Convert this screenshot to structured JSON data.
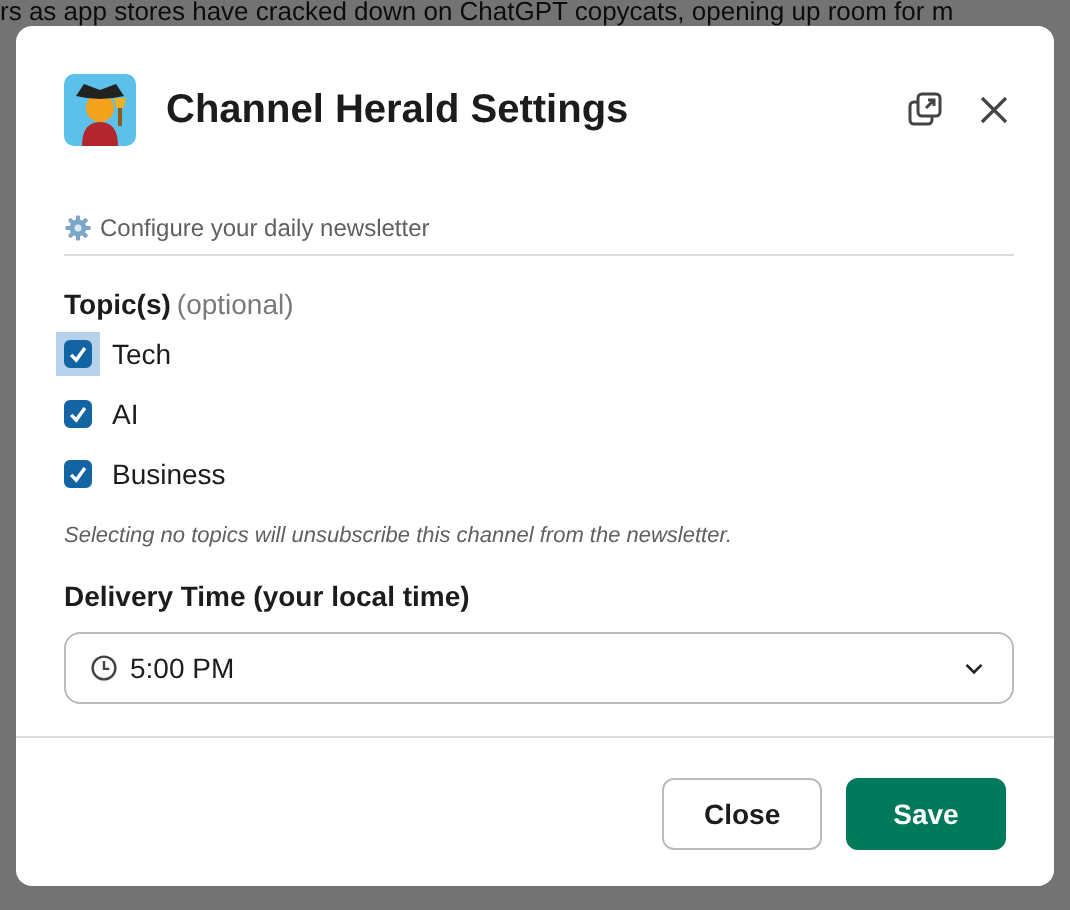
{
  "background": {
    "text": "rs as app stores have cracked down on ChatGPT copycats, opening up room for m"
  },
  "dialog": {
    "title": "Channel Herald Settings",
    "subtitle": "Configure your daily newsletter",
    "topics_label": {
      "label": "Topic(s)",
      "hint": "(optional)"
    },
    "topics": [
      {
        "label": "Tech",
        "checked": true,
        "focused": true
      },
      {
        "label": "AI",
        "checked": true,
        "focused": false
      },
      {
        "label": "Business",
        "checked": true,
        "focused": false
      }
    ],
    "note": "Selecting no topics will unsubscribe this channel from the newsletter.",
    "delivery_label": "Delivery Time (your local time)",
    "delivery_time": {
      "value": "5:00 PM"
    },
    "buttons": [
      {
        "label": "Close",
        "kind": "secondary"
      },
      {
        "label": "Save",
        "kind": "primary"
      }
    ]
  }
}
